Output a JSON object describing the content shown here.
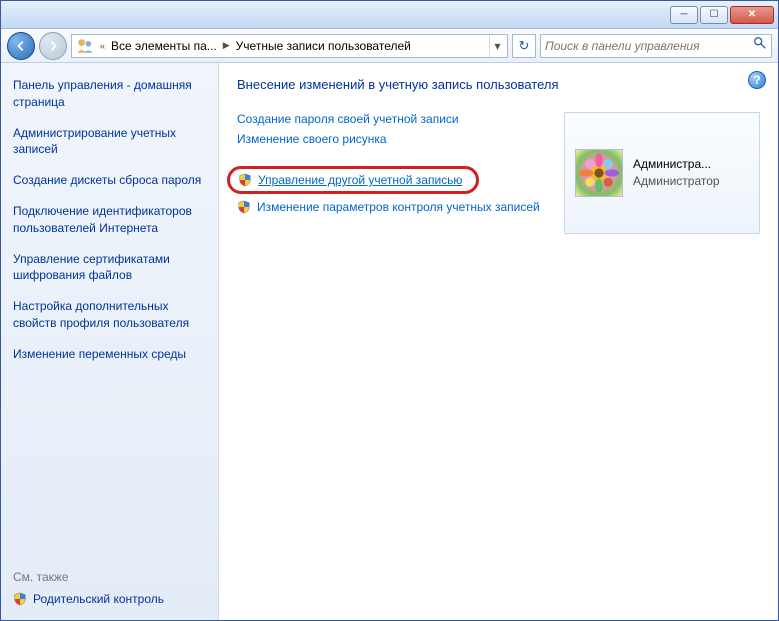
{
  "breadcrumb": {
    "item1": "Все элементы па...",
    "item2": "Учетные записи пользователей"
  },
  "search": {
    "placeholder": "Поиск в панели управления"
  },
  "sidebar": {
    "home": "Панель управления - домашняя страница",
    "tasks": [
      "Администрирование учетных записей",
      "Создание дискеты сброса пароля",
      "Подключение идентификаторов пользователей Интернета",
      "Управление сертификатами шифрования файлов",
      "Настройка дополнительных свойств профиля пользователя",
      "Изменение переменных среды"
    ],
    "seealso_label": "См. также",
    "seealso_item": "Родительский контроль"
  },
  "main": {
    "heading": "Внесение изменений в учетную запись пользователя",
    "links": {
      "create_password": "Создание пароля своей учетной записи",
      "change_picture": "Изменение своего рисунка",
      "manage_other": "Управление другой учетной записью",
      "change_uac": "Изменение параметров контроля учетных записей"
    }
  },
  "user": {
    "name": "Администра...",
    "role": "Администратор"
  }
}
